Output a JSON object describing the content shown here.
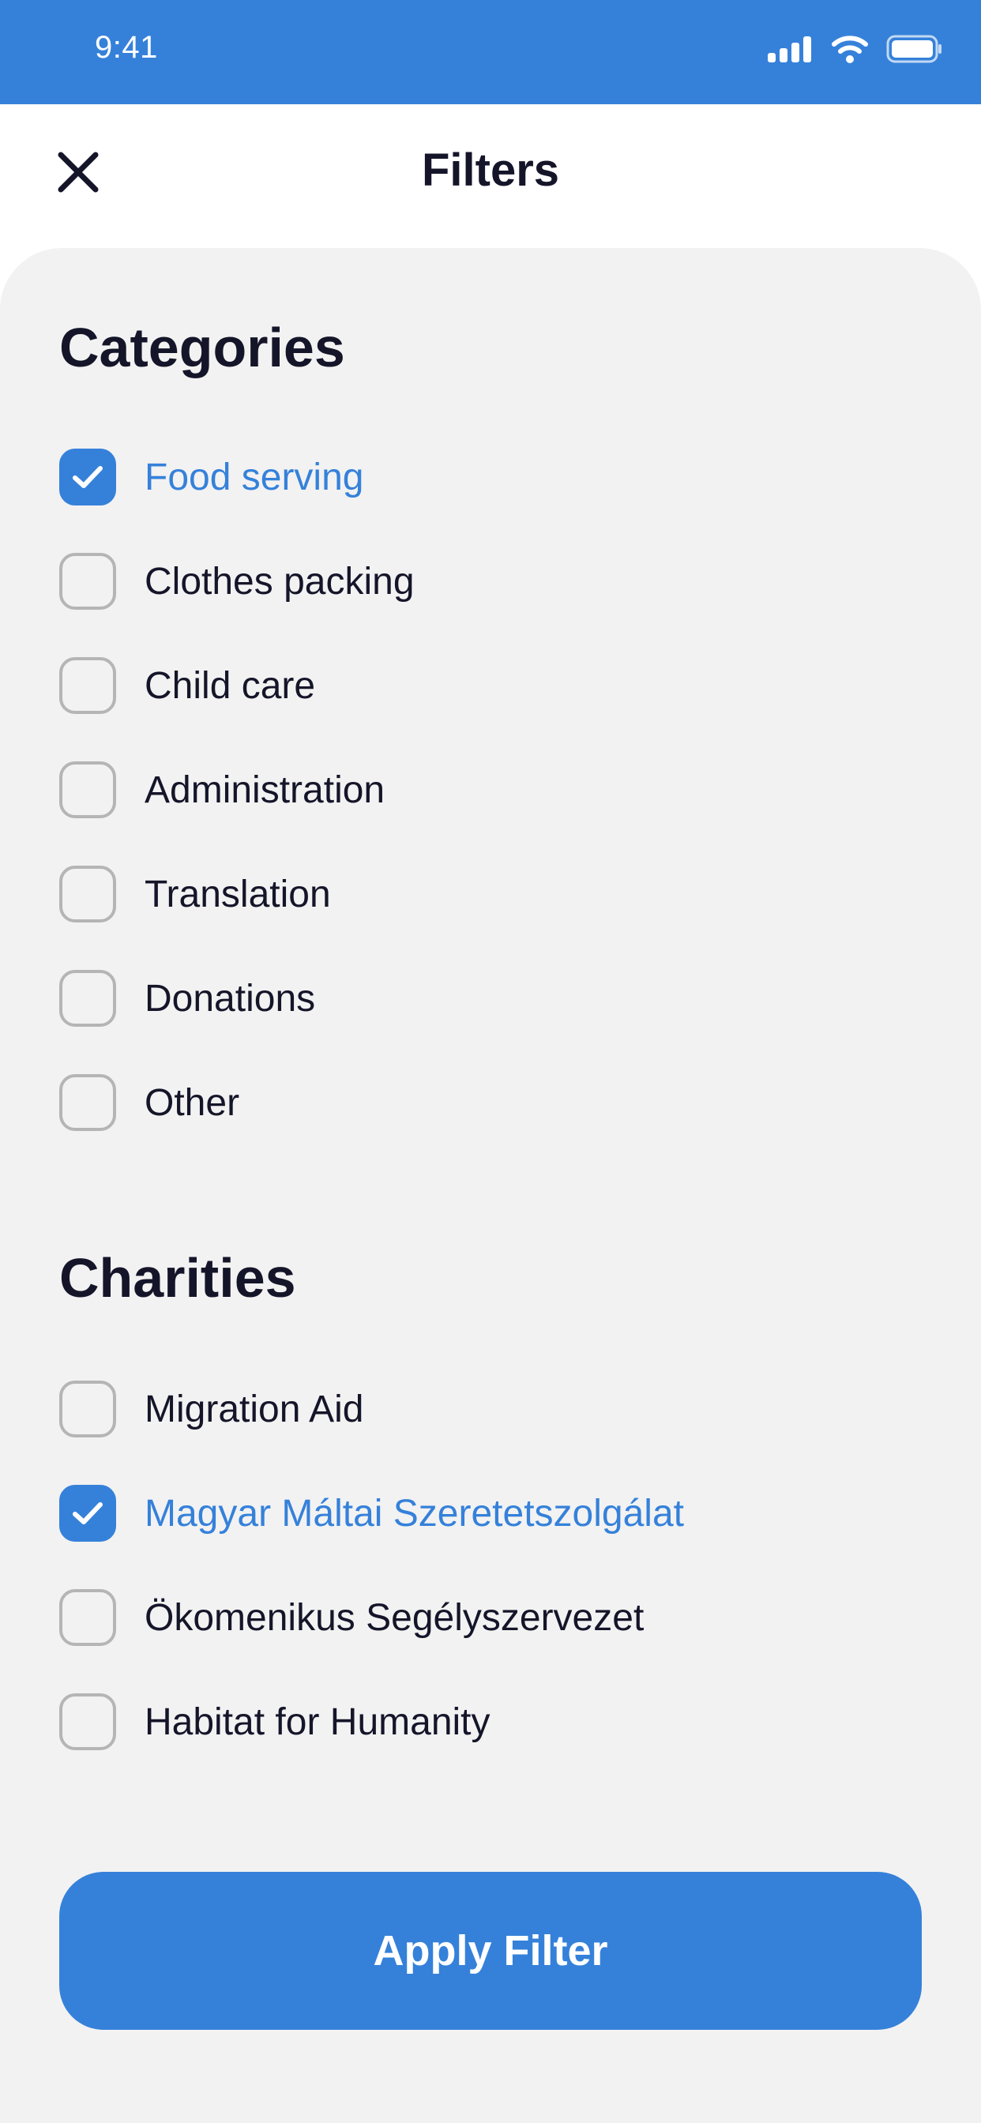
{
  "status_bar": {
    "time": "9:41",
    "icons": [
      "cellular-signal-icon",
      "wifi-icon",
      "battery-icon"
    ]
  },
  "header": {
    "title": "Filters",
    "close_icon": "close-icon"
  },
  "categories": {
    "title": "Categories",
    "items": [
      {
        "label": "Food serving",
        "checked": true
      },
      {
        "label": "Clothes packing",
        "checked": false
      },
      {
        "label": "Child care",
        "checked": false
      },
      {
        "label": "Administration",
        "checked": false
      },
      {
        "label": "Translation",
        "checked": false
      },
      {
        "label": "Donations",
        "checked": false
      },
      {
        "label": "Other",
        "checked": false
      }
    ]
  },
  "charities": {
    "title": "Charities",
    "items": [
      {
        "label": "Migration Aid",
        "checked": false
      },
      {
        "label": "Magyar Máltai Szeretetszolgálat",
        "checked": true
      },
      {
        "label": "Ökomenikus Segélyszervezet",
        "checked": false
      },
      {
        "label": "Habitat for Humanity",
        "checked": false
      }
    ]
  },
  "apply_button": {
    "label": "Apply Filter"
  },
  "colors": {
    "accent": "#3581da",
    "background": "#f2f2f2",
    "text": "#15152a",
    "checkbox_border": "#b5b5b5"
  }
}
